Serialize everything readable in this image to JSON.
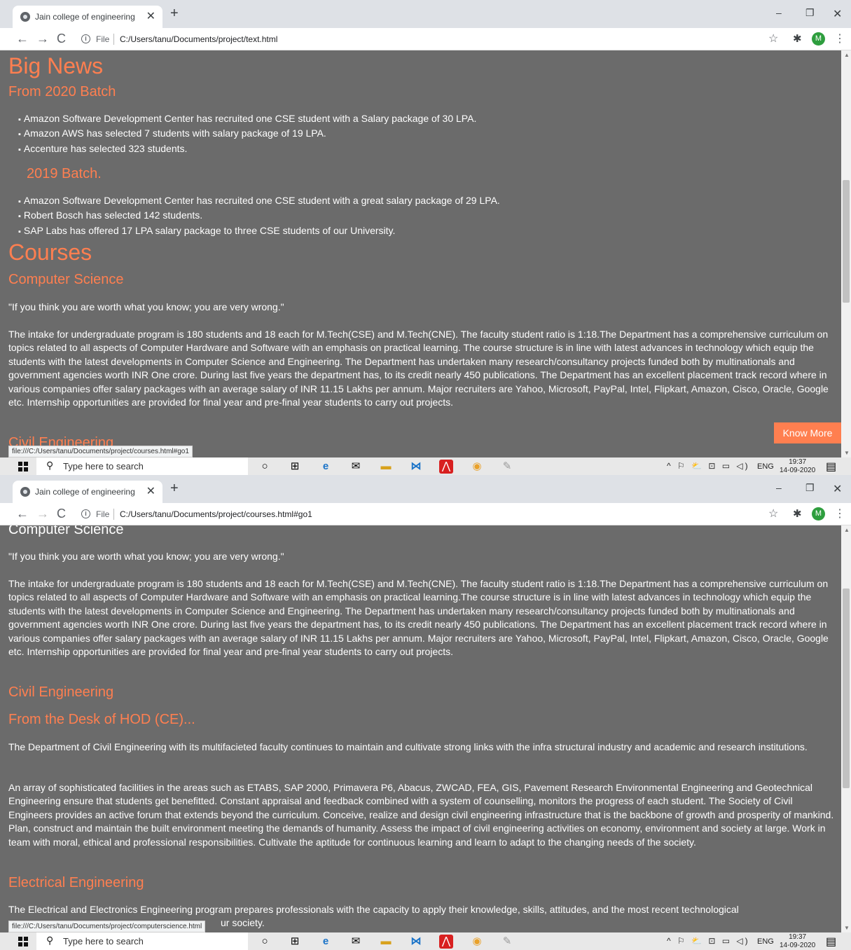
{
  "browser": {
    "tab_title": "Jain college of engineering",
    "tab_close": "✕",
    "new_tab": "+",
    "win_min": "–",
    "win_restore": "❐",
    "win_close": "✕",
    "back": "←",
    "forward": "→",
    "reload": "C",
    "info": "i",
    "file_label": "File",
    "star": "☆",
    "puzzle": "✱",
    "profile_initial": "M",
    "menu": "⋮"
  },
  "taskbar": {
    "search_glass": "⚲",
    "search_placeholder": "Type here to search",
    "tray_icons": "^ ⚐ ⛅ ⊡ ▭ ◁)",
    "language": "ENG",
    "time": "19:37",
    "date": "14-09-2020",
    "notif": "▤",
    "apps": [
      "○",
      "⊞",
      "e",
      "✉",
      "▬",
      "⋈",
      "⋀",
      "◉",
      "✎"
    ],
    "app_colors": [
      "#222222",
      "#333333",
      "#1a73c8",
      "#222222",
      "#d8a21d",
      "#1a73c8",
      "#d82020",
      "#e9a12a",
      "#999999"
    ]
  },
  "shot1": {
    "url": "C:/Users/tanu/Documents/project/text.html",
    "status_url": "file:///C:/Users/tanu/Documents/project/courses.html#go1",
    "big_news": "Big News",
    "from_2020": "From 2020 Batch",
    "batch2020_items": [
      "Amazon Software Development Center has recruited one CSE student with a Salary package of 30 LPA.",
      "Amazon AWS has selected 7 students with salary package of 19 LPA.",
      "Accenture has selected 323 students."
    ],
    "batch2019_heading": "2019 Batch.",
    "batch2019_items": [
      "Amazon Software Development Center has recruited one CSE student with a great salary package of 29 LPA.",
      "Robert Bosch has selected 142 students.",
      "SAP Labs has offered 17 LPA salary package to three CSE students of our University."
    ],
    "courses": "Courses",
    "computer_science": "Computer Science",
    "quote": "\"If you think you are worth what you know; you are very wrong.\"",
    "cs_para": "The intake for undergraduate program is 180 students and 18 each for M.Tech(CSE) and M.Tech(CNE). The faculty student ratio is 1:18.The Department has a comprehensive curriculum on topics related to all aspects of Computer Hardware and Software with an emphasis on practical learning. The course structure is in line with latest advances in technology which equip the students with the latest developments in Computer Science and Engineering. The Department has undertaken many research/consultancy projects funded both by multinationals and government agencies worth INR One crore. During last five years the department has, to its credit nearly 450 publications. The Department has an excellent placement track record where in various companies offer salary packages with an average salary of INR 11.15 Lakhs per annum. Major recruiters are Yahoo, Microsoft, PayPal, Intel, Flipkart, Amazon, Cisco, Oracle, Google etc. Internship opportunities are provided for final year and pre-final year students to carry out projects.",
    "know_more": "Know More",
    "civil_cut": "Civil Engineering"
  },
  "shot2": {
    "url": "C:/Users/tanu/Documents/project/courses.html#go1",
    "status_url": "file:///C:/Users/tanu/Documents/project/computerscience.html",
    "computer_science": "Computer Science",
    "quote": "\"If you think you are worth what you know; you are very wrong.\"",
    "cs_para": "The intake for undergraduate program is 180 students and 18 each for M.Tech(CSE) and M.Tech(CNE). The faculty student ratio is 1:18.The Department has a comprehensive curriculum on topics related to all aspects of Computer Hardware and Software with an emphasis on practical learning.The course structure is in line with latest advances in technology which equip the students with the latest developments in Computer Science and Engineering. The Department has undertaken many research/consultancy projects funded both by multinationals and government agencies worth INR One crore. During last five years the department has, to its credit nearly 450 publications. The Department has an excellent placement track record where in various companies offer salary packages with an average salary of INR 11.15 Lakhs per annum. Major recruiters are Yahoo, Microsoft, PayPal, Intel, Flipkart, Amazon, Cisco, Oracle, Google etc. Internship opportunities are provided for final year and pre-final year students to carry out projects.",
    "civil": "Civil Engineering",
    "hod": "From the Desk of HOD (CE)...",
    "civil_para1": "The Department of Civil Engineering with its multifacieted faculty continues to maintain and cultivate strong links with the infra structural industry and academic and research institutions.",
    "civil_para2": "An array of sophisticated facilities in the areas such as ETABS, SAP 2000, Primavera P6, Abacus, ZWCAD, FEA, GIS, Pavement Research Environmental Engineering and Geotechnical Engineering ensure that students get benefitted. Constant appraisal and feedback combined with a system of counselling, monitors the progress of each student. The Society of Civil Engineers provides an active forum that extends beyond the curriculum. Conceive, realize and design civil engineering infrastructure that is the backbone of growth and prosperity of mankind. Plan, construct and maintain the built environment meeting the demands of humanity. Assess the impact of civil engineering activities on economy, environment and society at large. Work in team with moral, ethical and professional responsibilities. Cultivate the aptitude for continuous learning and learn to adapt to the changing needs of the society.",
    "electrical": "Electrical Engineering",
    "electrical_para": "The Electrical and Electronics Engineering program prepares professionals with the capacity to apply their knowledge, skills, attitudes, and the most recent technological",
    "electrical_tail": "ur society."
  }
}
